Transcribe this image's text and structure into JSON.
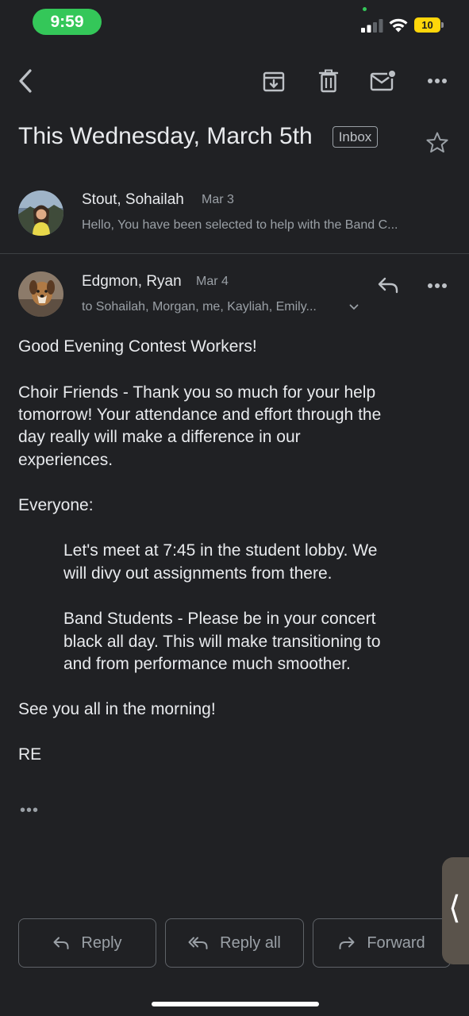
{
  "status_bar": {
    "time": "9:59",
    "battery": "10"
  },
  "toolbar": {
    "icons": [
      "back-arrow-icon",
      "archive-icon",
      "trash-icon",
      "mark-unread-icon",
      "more-icon"
    ]
  },
  "subject": {
    "title": "This Wednesday, March 5th",
    "label": "Inbox"
  },
  "thread": {
    "collapsed_message": {
      "sender": "Stout, Sohailah",
      "date": "Mar 3",
      "snippet": "Hello, You have been selected to help with the Band C..."
    },
    "open_message": {
      "sender": "Edgmon, Ryan",
      "date": "Mar 4",
      "recipients": "to Sohailah, Morgan, me, Kayliah, Emily...",
      "body": {
        "greeting": "Good Evening Contest Workers!",
        "p1_line1": "Choir Friends -  Thank you so much for your help",
        "p1_line2": "tomorrow!  Your attendance and effort through the",
        "p1_line3": "day really will make a difference in our",
        "p1_line4": "experiences.",
        "everyone": "Everyone:",
        "p2_line1": "Let's meet at 7:45 in the student lobby.  We",
        "p2_line2": "will divy out assignments from there.",
        "p3_line1": "Band Students - Please be in your concert",
        "p3_line2": "black all day.  This will make transitioning to",
        "p3_line3": "and from performance much smoother.",
        "closing": "See you all in the morning!",
        "signature": "RE"
      },
      "trimmed_indicator": "•••"
    }
  },
  "actions": {
    "reply": "Reply",
    "reply_all": "Reply all",
    "forward": "Forward"
  },
  "colors": {
    "background": "#202124",
    "text_primary": "#e8eaed",
    "text_secondary": "#9aa0a6",
    "time_pill": "#34c759",
    "battery": "#ffd60a"
  }
}
